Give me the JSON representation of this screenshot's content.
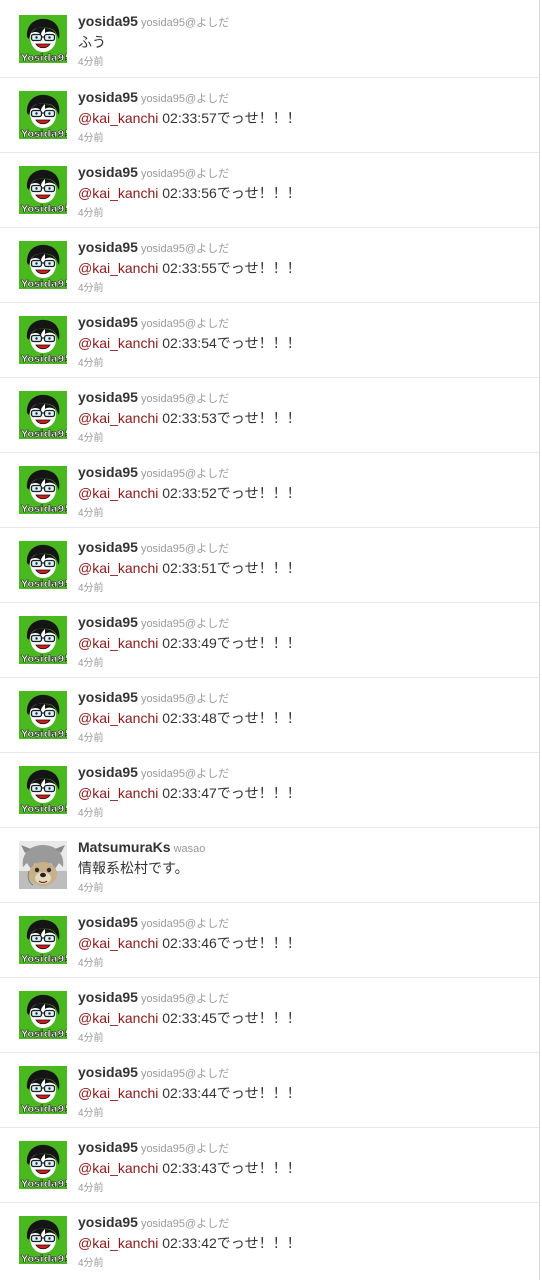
{
  "colors": {
    "mention": "#8b1a1a",
    "screen_name": "#333333",
    "meta": "#999999",
    "avatar_green": "#4ab81f"
  },
  "tweets": [
    {
      "avatar": "yosida-avatar",
      "screen_name": "yosida95",
      "full_name": "yosida95@よしだ",
      "mention": "",
      "text": "ふう",
      "time": "4分前"
    },
    {
      "avatar": "yosida-avatar",
      "screen_name": "yosida95",
      "full_name": "yosida95@よしだ",
      "mention": "@kai_kanchi",
      "text": " 02:33:57でっせ！！！",
      "time": "4分前"
    },
    {
      "avatar": "yosida-avatar",
      "screen_name": "yosida95",
      "full_name": "yosida95@よしだ",
      "mention": "@kai_kanchi",
      "text": " 02:33:56でっせ！！！",
      "time": "4分前"
    },
    {
      "avatar": "yosida-avatar",
      "screen_name": "yosida95",
      "full_name": "yosida95@よしだ",
      "mention": "@kai_kanchi",
      "text": " 02:33:55でっせ！！！",
      "time": "4分前"
    },
    {
      "avatar": "yosida-avatar",
      "screen_name": "yosida95",
      "full_name": "yosida95@よしだ",
      "mention": "@kai_kanchi",
      "text": " 02:33:54でっせ！！！",
      "time": "4分前"
    },
    {
      "avatar": "yosida-avatar",
      "screen_name": "yosida95",
      "full_name": "yosida95@よしだ",
      "mention": "@kai_kanchi",
      "text": " 02:33:53でっせ！！！",
      "time": "4分前"
    },
    {
      "avatar": "yosida-avatar",
      "screen_name": "yosida95",
      "full_name": "yosida95@よしだ",
      "mention": "@kai_kanchi",
      "text": " 02:33:52でっせ！！！",
      "time": "4分前"
    },
    {
      "avatar": "yosida-avatar",
      "screen_name": "yosida95",
      "full_name": "yosida95@よしだ",
      "mention": "@kai_kanchi",
      "text": " 02:33:51でっせ！！！",
      "time": "4分前"
    },
    {
      "avatar": "yosida-avatar",
      "screen_name": "yosida95",
      "full_name": "yosida95@よしだ",
      "mention": "@kai_kanchi",
      "text": " 02:33:49でっせ！！！",
      "time": "4分前"
    },
    {
      "avatar": "yosida-avatar",
      "screen_name": "yosida95",
      "full_name": "yosida95@よしだ",
      "mention": "@kai_kanchi",
      "text": " 02:33:48でっせ！！！",
      "time": "4分前"
    },
    {
      "avatar": "yosida-avatar",
      "screen_name": "yosida95",
      "full_name": "yosida95@よしだ",
      "mention": "@kai_kanchi",
      "text": " 02:33:47でっせ！！！",
      "time": "4分前"
    },
    {
      "avatar": "matsumura-avatar",
      "screen_name": "MatsumuraKs",
      "full_name": "wasao",
      "mention": "",
      "text": "情報系松村です。",
      "time": "4分前"
    },
    {
      "avatar": "yosida-avatar",
      "screen_name": "yosida95",
      "full_name": "yosida95@よしだ",
      "mention": "@kai_kanchi",
      "text": " 02:33:46でっせ！！！",
      "time": "4分前"
    },
    {
      "avatar": "yosida-avatar",
      "screen_name": "yosida95",
      "full_name": "yosida95@よしだ",
      "mention": "@kai_kanchi",
      "text": " 02:33:45でっせ！！！",
      "time": "4分前"
    },
    {
      "avatar": "yosida-avatar",
      "screen_name": "yosida95",
      "full_name": "yosida95@よしだ",
      "mention": "@kai_kanchi",
      "text": " 02:33:44でっせ！！！",
      "time": "4分前"
    },
    {
      "avatar": "yosida-avatar",
      "screen_name": "yosida95",
      "full_name": "yosida95@よしだ",
      "mention": "@kai_kanchi",
      "text": " 02:33:43でっせ！！！",
      "time": "4分前"
    },
    {
      "avatar": "yosida-avatar",
      "screen_name": "yosida95",
      "full_name": "yosida95@よしだ",
      "mention": "@kai_kanchi",
      "text": " 02:33:42でっせ！！！",
      "time": "4分前"
    }
  ]
}
